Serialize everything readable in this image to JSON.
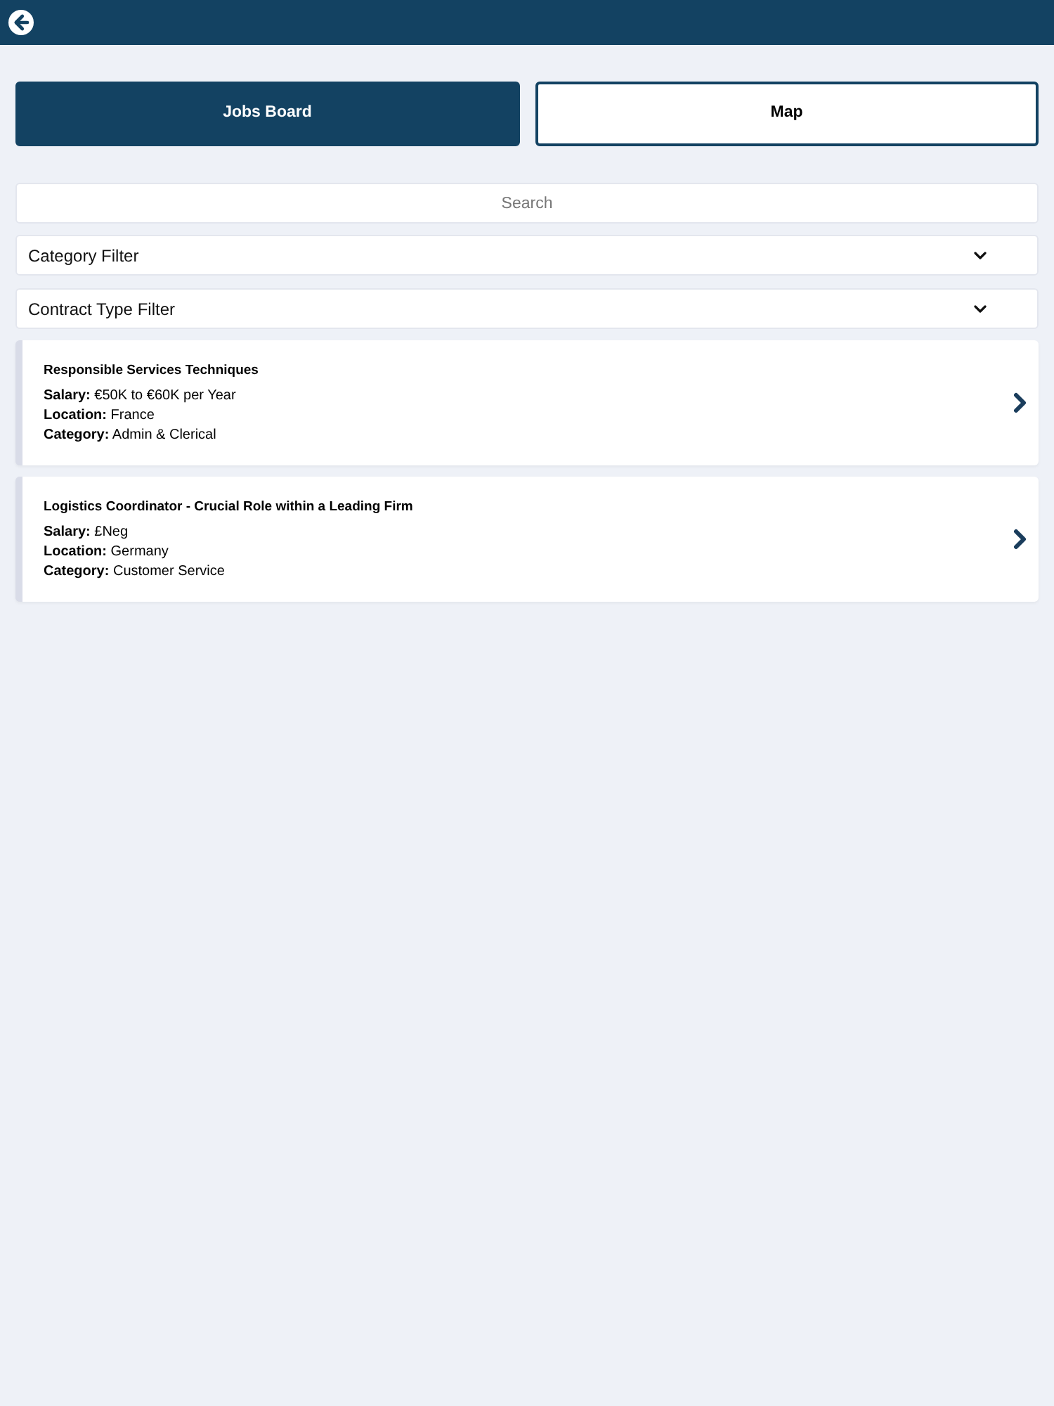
{
  "tabs": [
    {
      "label": "Jobs Board",
      "selected": true
    },
    {
      "label": "Map",
      "selected": false
    }
  ],
  "search": {
    "placeholder": "Search"
  },
  "filters": [
    {
      "label": "Category Filter"
    },
    {
      "label": "Contract Type Filter"
    }
  ],
  "jobs": [
    {
      "title": "Responsible Services Techniques",
      "fields": [
        {
          "label": "Salary:",
          "value": "€50K to €60K per Year"
        },
        {
          "label": "Location:",
          "value": "France"
        },
        {
          "label": "Category:",
          "value": "Admin & Clerical"
        }
      ]
    },
    {
      "title": "Logistics Coordinator - Crucial Role within a Leading Firm",
      "fields": [
        {
          "label": "Salary:",
          "value": "£Neg"
        },
        {
          "label": "Location:",
          "value": "Germany"
        },
        {
          "label": "Category:",
          "value": "Customer Service"
        }
      ]
    }
  ]
}
